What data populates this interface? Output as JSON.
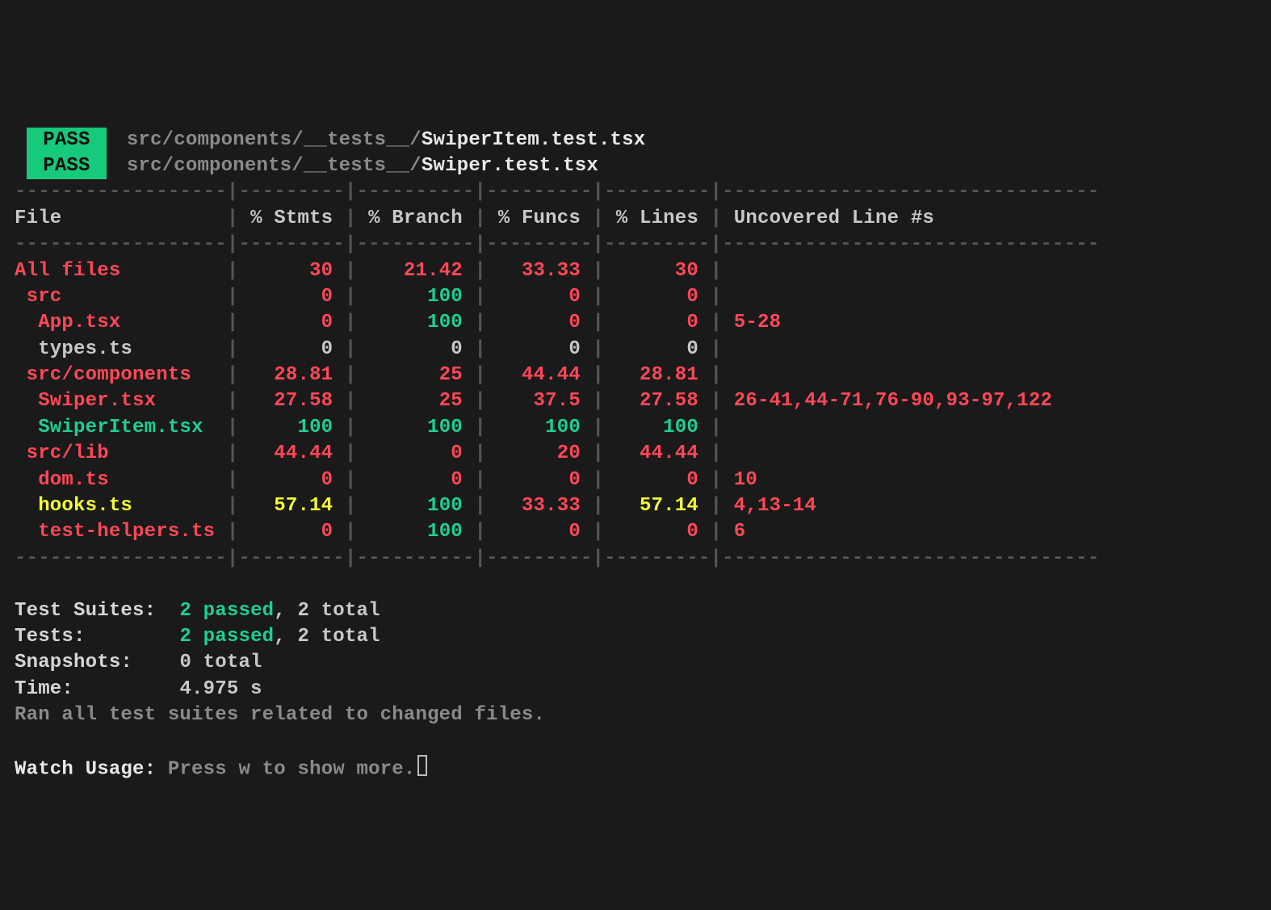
{
  "pass_label": "PASS",
  "tests": [
    {
      "path_dim": "src/components/__tests__/",
      "path_file": "SwiperItem.test.tsx"
    },
    {
      "path_dim": "src/components/__tests__/",
      "path_file": "Swiper.test.tsx"
    }
  ],
  "coverage": {
    "headers": {
      "file": "File",
      "stmts": "% Stmts",
      "branch": "% Branch",
      "funcs": "% Funcs",
      "lines": "% Lines",
      "uncov": "Uncovered Line #s"
    },
    "rows": [
      {
        "file": "All files",
        "indent": 0,
        "file_cls": "red",
        "stmts": "30",
        "stmts_cls": "red",
        "branch": "21.42",
        "branch_cls": "red",
        "funcs": "33.33",
        "funcs_cls": "red",
        "lines": "30",
        "lines_cls": "red",
        "uncov": "",
        "uncov_cls": ""
      },
      {
        "file": "src",
        "indent": 1,
        "file_cls": "red",
        "stmts": "0",
        "stmts_cls": "red",
        "branch": "100",
        "branch_cls": "green",
        "funcs": "0",
        "funcs_cls": "red",
        "lines": "0",
        "lines_cls": "red",
        "uncov": "",
        "uncov_cls": ""
      },
      {
        "file": "App.tsx",
        "indent": 2,
        "file_cls": "red",
        "stmts": "0",
        "stmts_cls": "red",
        "branch": "100",
        "branch_cls": "green",
        "funcs": "0",
        "funcs_cls": "red",
        "lines": "0",
        "lines_cls": "red",
        "uncov": "5-28",
        "uncov_cls": "red"
      },
      {
        "file": "types.ts",
        "indent": 2,
        "file_cls": "",
        "stmts": "0",
        "stmts_cls": "",
        "branch": "0",
        "branch_cls": "",
        "funcs": "0",
        "funcs_cls": "",
        "lines": "0",
        "lines_cls": "",
        "uncov": "",
        "uncov_cls": ""
      },
      {
        "file": "src/components",
        "indent": 1,
        "file_cls": "red",
        "stmts": "28.81",
        "stmts_cls": "red",
        "branch": "25",
        "branch_cls": "red",
        "funcs": "44.44",
        "funcs_cls": "red",
        "lines": "28.81",
        "lines_cls": "red",
        "uncov": "",
        "uncov_cls": ""
      },
      {
        "file": "Swiper.tsx",
        "indent": 2,
        "file_cls": "red",
        "stmts": "27.58",
        "stmts_cls": "red",
        "branch": "25",
        "branch_cls": "red",
        "funcs": "37.5",
        "funcs_cls": "red",
        "lines": "27.58",
        "lines_cls": "red",
        "uncov": "26-41,44-71,76-90,93-97,122",
        "uncov_cls": "red"
      },
      {
        "file": "SwiperItem.tsx",
        "indent": 2,
        "file_cls": "green",
        "stmts": "100",
        "stmts_cls": "green",
        "branch": "100",
        "branch_cls": "green",
        "funcs": "100",
        "funcs_cls": "green",
        "lines": "100",
        "lines_cls": "green",
        "uncov": "",
        "uncov_cls": ""
      },
      {
        "file": "src/lib",
        "indent": 1,
        "file_cls": "red",
        "stmts": "44.44",
        "stmts_cls": "red",
        "branch": "0",
        "branch_cls": "red",
        "funcs": "20",
        "funcs_cls": "red",
        "lines": "44.44",
        "lines_cls": "red",
        "uncov": "",
        "uncov_cls": ""
      },
      {
        "file": "dom.ts",
        "indent": 2,
        "file_cls": "red",
        "stmts": "0",
        "stmts_cls": "red",
        "branch": "0",
        "branch_cls": "red",
        "funcs": "0",
        "funcs_cls": "red",
        "lines": "0",
        "lines_cls": "red",
        "uncov": "10",
        "uncov_cls": "red"
      },
      {
        "file": "hooks.ts",
        "indent": 2,
        "file_cls": "yellow",
        "stmts": "57.14",
        "stmts_cls": "yellow",
        "branch": "100",
        "branch_cls": "green",
        "funcs": "33.33",
        "funcs_cls": "red",
        "lines": "57.14",
        "lines_cls": "yellow",
        "uncov": "4,13-14",
        "uncov_cls": "red"
      },
      {
        "file": "test-helpers.ts",
        "indent": 2,
        "file_cls": "red",
        "stmts": "0",
        "stmts_cls": "red",
        "branch": "100",
        "branch_cls": "green",
        "funcs": "0",
        "funcs_cls": "red",
        "lines": "0",
        "lines_cls": "red",
        "uncov": "6",
        "uncov_cls": "red"
      }
    ]
  },
  "summary": {
    "test_suites_label": "Test Suites:",
    "test_suites_passed": "2 passed",
    "test_suites_total": "2 total",
    "tests_label": "Tests:",
    "tests_passed": "2 passed",
    "tests_total": "2 total",
    "snapshots_label": "Snapshots:",
    "snapshots_value": "0 total",
    "time_label": "Time:",
    "time_value": "4.975 s",
    "ran_msg": "Ran all test suites related to changed files."
  },
  "watch": {
    "label": "Watch Usage:",
    "hint_prefix": "Press ",
    "hint_key": "w",
    "hint_suffix": " to show more."
  },
  "widths": {
    "file": 18,
    "stmts": 9,
    "branch": 10,
    "funcs": 9,
    "lines": 9
  }
}
